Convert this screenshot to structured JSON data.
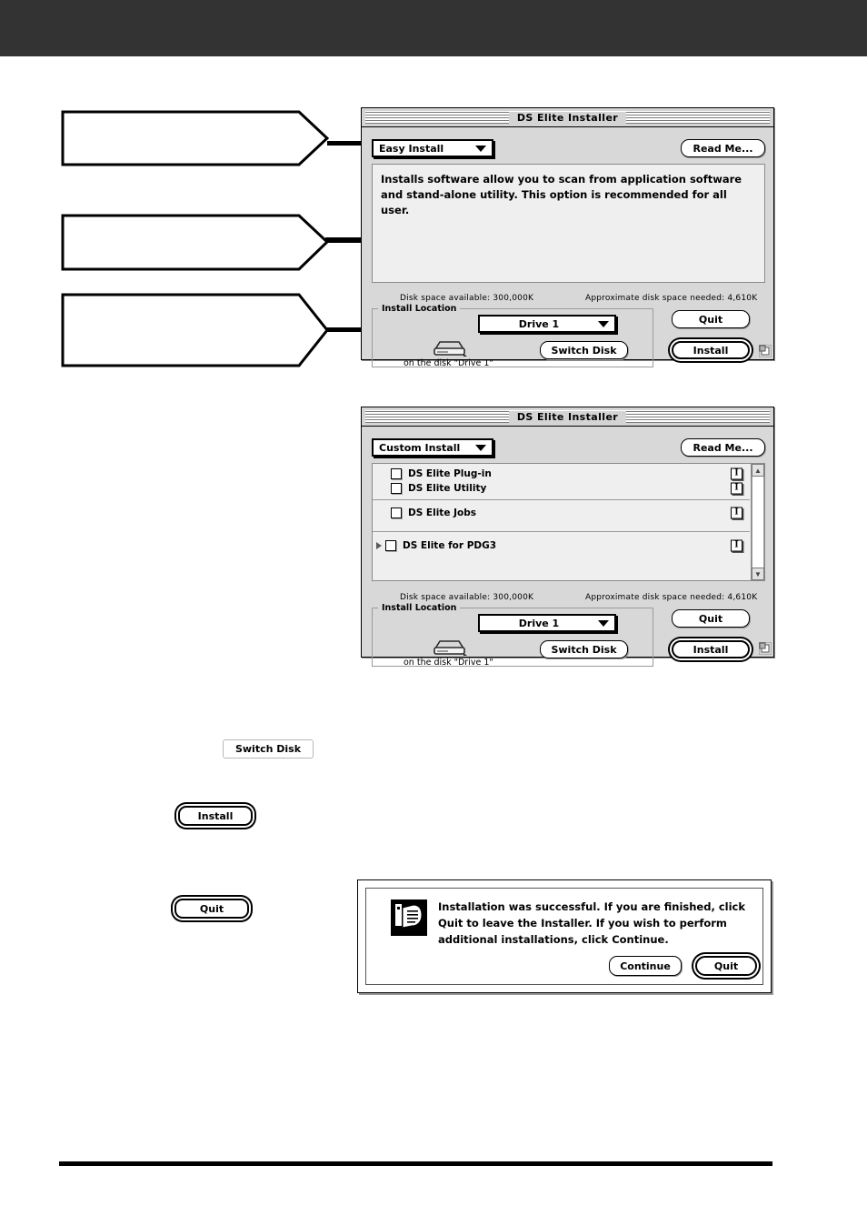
{
  "page": {
    "title_band_color": "#333333",
    "background_color": "#ffffff"
  },
  "callouts": [
    {
      "name": "callout-install-type",
      "text": ""
    },
    {
      "name": "callout-destination-popup",
      "text": ""
    },
    {
      "name": "callout-destination-disk",
      "text": ""
    }
  ],
  "easy_install_window": {
    "title": "DS Elite  Installer",
    "popup": {
      "label": "Easy Install",
      "arrow": "chevron-down-icon"
    },
    "read_me_button": "Read Me...",
    "description": "Installs software allow you to scan from application software and stand-alone utility. This option is recommended for all user.",
    "disk_space_available": "Disk space available: 300,000K",
    "disk_space_needed": "Approximate disk space needed: 4,610K",
    "install_location": {
      "group_title": "Install Location",
      "drive_popup": "Drive 1",
      "on_the_disk": "on the disk \"Drive 1\"",
      "switch_disk_button": "Switch Disk",
      "disk_icon": "hard-disk-icon"
    },
    "quit_button": "Quit",
    "install_button": "Install",
    "grow_box": "resize-grow-box-icon"
  },
  "custom_install_window": {
    "title": "DS Elite  Installer",
    "popup": {
      "label": "Custom Install",
      "arrow": "chevron-down-icon"
    },
    "read_me_button": "Read Me...",
    "list_groups": [
      {
        "items": [
          {
            "label": "DS Elite Plug-in",
            "checked": false,
            "expandable": false,
            "info": "I"
          },
          {
            "label": "DS Elite Utility",
            "checked": false,
            "expandable": false,
            "info": "I"
          }
        ]
      },
      {
        "items": [
          {
            "label": "DS Elite Jobs",
            "checked": false,
            "expandable": false,
            "info": "I"
          }
        ]
      },
      {
        "items": [
          {
            "label": "DS Elite for PDG3",
            "checked": false,
            "expandable": true,
            "info": "I"
          }
        ]
      }
    ],
    "scrollbar": {
      "up_arrow": "scroll-up-arrow-icon",
      "down_arrow": "scroll-down-arrow-icon"
    },
    "disk_space_available": "Disk space available: 300,000K",
    "disk_space_needed": "Approximate disk space needed: 4,610K",
    "install_location": {
      "group_title": "Install Location",
      "drive_popup": "Drive 1",
      "on_the_disk": "on the disk \"Drive 1\"",
      "switch_disk_button": "Switch Disk",
      "disk_icon": "hard-disk-icon"
    },
    "quit_button": "Quit",
    "install_button": "Install",
    "grow_box": "resize-grow-box-icon"
  },
  "figures": {
    "switch_disk": "Switch Disk",
    "install": "Install",
    "quit": "Quit"
  },
  "alert": {
    "icon": "installer-document-icon",
    "message": "Installation was successful. If you are finished, click Quit to leave the Installer. If you wish to perform additional installations, click Continue.",
    "continue_button": "Continue",
    "quit_button": "Quit"
  }
}
